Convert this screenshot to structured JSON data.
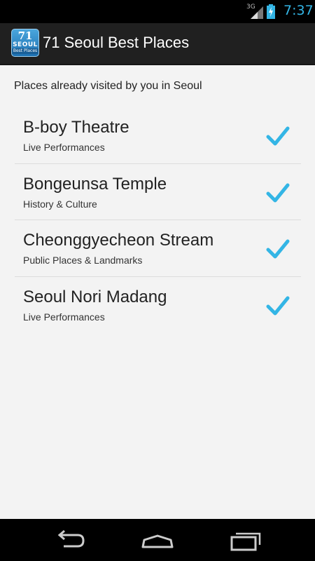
{
  "status_bar": {
    "network": "3G",
    "time": "7:37",
    "accent": "#33b5e5"
  },
  "action_bar": {
    "icon": {
      "number": "71",
      "city": "SEOUL",
      "tagline": "Best Places"
    },
    "title": "71 Seoul Best Places"
  },
  "content": {
    "subtitle": "Places already visited by you in Seoul",
    "places": [
      {
        "name": "B-boy Theatre",
        "category": "Live Performances",
        "visited": true
      },
      {
        "name": "Bongeunsa Temple",
        "category": "History & Culture",
        "visited": true
      },
      {
        "name": "Cheonggyecheon Stream",
        "category": "Public Places & Landmarks",
        "visited": true
      },
      {
        "name": "Seoul Nori Madang",
        "category": "Live Performances",
        "visited": true
      }
    ],
    "check_color": "#33b5e5"
  },
  "nav_bar": {
    "buttons": [
      "back-icon",
      "home-icon",
      "recent-apps-icon"
    ]
  }
}
